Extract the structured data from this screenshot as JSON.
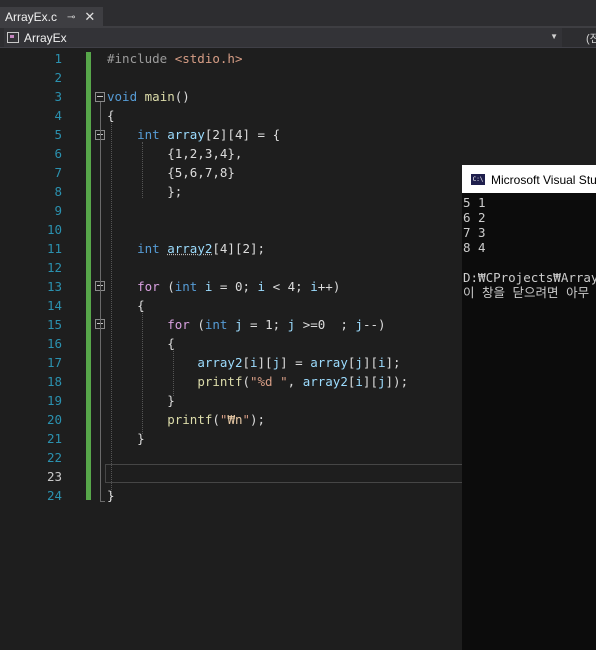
{
  "tab": {
    "name": "ArrayEx.c",
    "pin": "⊸",
    "close": "✕"
  },
  "nav": {
    "project": "ArrayEx",
    "right_text": "(전"
  },
  "lines": [
    {
      "n": "1",
      "t": [
        [
          "pp",
          "#include "
        ],
        [
          "hdr",
          "<stdio.h>"
        ]
      ]
    },
    {
      "n": "2",
      "t": []
    },
    {
      "n": "3",
      "t": [
        [
          "kw",
          "void"
        ],
        [
          "",
          " "
        ],
        [
          "fn",
          "main"
        ],
        [
          "",
          "()"
        ]
      ]
    },
    {
      "n": "4",
      "t": [
        [
          "",
          "{"
        ]
      ]
    },
    {
      "n": "5",
      "t": [
        [
          "",
          "    "
        ],
        [
          "kw",
          "int"
        ],
        [
          "",
          " "
        ],
        [
          "var",
          "array"
        ],
        [
          "",
          "[2][4] = {"
        ]
      ]
    },
    {
      "n": "6",
      "t": [
        [
          "",
          "        {1,2,3,4},"
        ]
      ]
    },
    {
      "n": "7",
      "t": [
        [
          "",
          "        {5,6,7,8}"
        ]
      ]
    },
    {
      "n": "8",
      "t": [
        [
          "",
          "        };"
        ]
      ]
    },
    {
      "n": "9",
      "t": []
    },
    {
      "n": "10",
      "t": []
    },
    {
      "n": "11",
      "t": [
        [
          "",
          "    "
        ],
        [
          "kw",
          "int"
        ],
        [
          "",
          " "
        ],
        [
          "var squig",
          "array2"
        ],
        [
          "",
          "[4][2];"
        ]
      ]
    },
    {
      "n": "12",
      "t": []
    },
    {
      "n": "13",
      "t": [
        [
          "",
          "    "
        ],
        [
          "ctl",
          "for"
        ],
        [
          "",
          " ("
        ],
        [
          "kw",
          "int"
        ],
        [
          "",
          " "
        ],
        [
          "var",
          "i"
        ],
        [
          "",
          " = 0; "
        ],
        [
          "var",
          "i"
        ],
        [
          "",
          " < 4; "
        ],
        [
          "var",
          "i"
        ],
        [
          "",
          "++)"
        ]
      ]
    },
    {
      "n": "14",
      "t": [
        [
          "",
          "    {"
        ]
      ]
    },
    {
      "n": "15",
      "t": [
        [
          "",
          "        "
        ],
        [
          "ctl",
          "for"
        ],
        [
          "",
          " ("
        ],
        [
          "kw",
          "int"
        ],
        [
          "",
          " "
        ],
        [
          "var",
          "j"
        ],
        [
          "",
          " = 1; "
        ],
        [
          "var",
          "j"
        ],
        [
          "",
          " >=0  ; "
        ],
        [
          "var",
          "j"
        ],
        [
          "",
          "--)"
        ]
      ]
    },
    {
      "n": "16",
      "t": [
        [
          "",
          "        {"
        ]
      ]
    },
    {
      "n": "17",
      "t": [
        [
          "",
          "            "
        ],
        [
          "var",
          "array2"
        ],
        [
          "",
          "["
        ],
        [
          "var",
          "i"
        ],
        [
          "",
          "]["
        ],
        [
          "var",
          "j"
        ],
        [
          "",
          "] = "
        ],
        [
          "var",
          "array"
        ],
        [
          "",
          "["
        ],
        [
          "var",
          "j"
        ],
        [
          "",
          "]["
        ],
        [
          "var",
          "i"
        ],
        [
          "",
          "];"
        ]
      ]
    },
    {
      "n": "18",
      "t": [
        [
          "",
          "            "
        ],
        [
          "fn",
          "printf"
        ],
        [
          "",
          "("
        ],
        [
          "str",
          "\"%d \""
        ],
        [
          "",
          ", "
        ],
        [
          "var",
          "array2"
        ],
        [
          "",
          "["
        ],
        [
          "var",
          "i"
        ],
        [
          "",
          "]["
        ],
        [
          "var",
          "j"
        ],
        [
          "",
          "]);"
        ]
      ]
    },
    {
      "n": "19",
      "t": [
        [
          "",
          "        }"
        ]
      ]
    },
    {
      "n": "20",
      "t": [
        [
          "",
          "        "
        ],
        [
          "fn",
          "printf"
        ],
        [
          "",
          "("
        ],
        [
          "str",
          "\""
        ],
        [
          "esc",
          "₩n"
        ],
        [
          "str",
          "\""
        ],
        [
          "",
          ");"
        ]
      ]
    },
    {
      "n": "21",
      "t": [
        [
          "",
          "    }"
        ]
      ]
    },
    {
      "n": "22",
      "t": []
    },
    {
      "n": "23",
      "t": [],
      "current": true
    },
    {
      "n": "24",
      "t": [
        [
          "",
          "}"
        ]
      ]
    }
  ],
  "console": {
    "title": "Microsoft Visual Studio 디버그 콘솔",
    "icon_text": "C:\\",
    "output": [
      "5 1",
      "6 2",
      "7 3",
      "8 4",
      "",
      "D:₩CProjects₩ArrayEx₩Debug₩ArrayEx.exe",
      "이 창을 닫으려면 아무 키나 누르세요..."
    ]
  },
  "colors": {
    "keyword": "#569cd6",
    "function": "#dcdcaa",
    "variable": "#9cdcfe",
    "string": "#d69d85",
    "control": "#d8a0df",
    "line_number": "#2b91af",
    "change_bar": "#57a64a"
  }
}
